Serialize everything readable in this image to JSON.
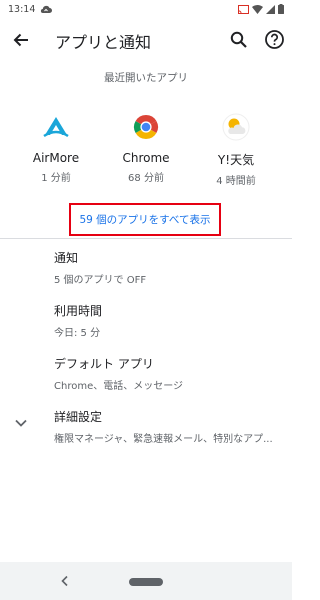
{
  "status_bar": {
    "time": "13:14"
  },
  "app_bar": {
    "title": "アプリと通知"
  },
  "recent": {
    "section_title": "最近開いたアプリ",
    "apps": [
      {
        "name": "AirMore",
        "time": "1 分前",
        "icon": "airmore-icon"
      },
      {
        "name": "Chrome",
        "time": "68 分前",
        "icon": "chrome-icon"
      },
      {
        "name": "Y!天気",
        "time": "4 時間前",
        "icon": "weather-icon"
      }
    ],
    "see_all": "59 個のアプリをすべて表示"
  },
  "prefs": [
    {
      "title": "通知",
      "summary": "5 個のアプリで OFF"
    },
    {
      "title": "利用時間",
      "summary": "今日: 5 分"
    },
    {
      "title": "デフォルト アプリ",
      "summary": "Chrome、電話、メッセージ"
    },
    {
      "title": "詳細設定",
      "summary": "権限マネージャ、緊急速報メール、特別なアプ..."
    }
  ],
  "colors": {
    "accent": "#1a73e8",
    "highlight_box": "#e60012"
  }
}
